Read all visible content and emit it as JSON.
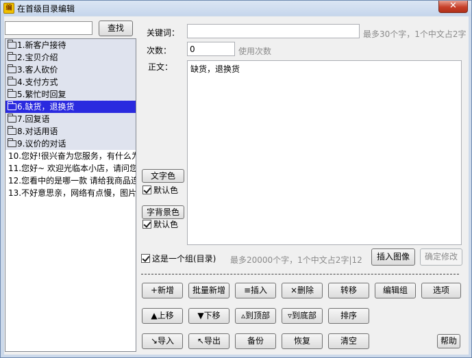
{
  "window": {
    "title": "在首级目录编辑",
    "close_glyph": "✕",
    "icon_glyph": "编"
  },
  "search": {
    "value": "",
    "button": "查找"
  },
  "tree": {
    "groups": [
      "1.新客户接待",
      "2.宝贝介绍",
      "3.客人砍价",
      "4.支付方式",
      "5.繁忙时回复",
      "6.缺货，退换货",
      "7.回复语",
      "8.对话用语",
      "9.议价的对话"
    ],
    "selected_index": 5,
    "items": [
      "10.您好!很兴奋为您服务，有什么为",
      "11.您好~ 欢迎光临本小店，请问您",
      "12.您看中的是哪一款 请给我商品连",
      "13.不好意思亲，网络有点慢，图片"
    ]
  },
  "form": {
    "keyword_label": "关键词：",
    "keyword_value": "",
    "keyword_hint": "最多30个字，1个中文占2字",
    "count_label": "次数：",
    "count_value": "0",
    "count_hint": "使用次数",
    "body_label": "正文：",
    "body_value": "缺货，退换货",
    "text_color_button": "文字色",
    "text_color_default": "默认色",
    "bg_color_button": "字背景色",
    "bg_color_default": "默认色",
    "is_group_label": "这是一个组(目录)",
    "body_hint": "最多20000个字，1个中文占2字|12",
    "insert_image_button": "插入图像",
    "confirm_button": "确定修改"
  },
  "actions": {
    "row1": [
      "+新增",
      "批量新增",
      "≡插入",
      "×删除",
      "转移",
      "编辑组",
      "选项"
    ],
    "row2": [
      "▲上移",
      "▼下移",
      "▵到顶部",
      "▿到底部",
      "排序"
    ],
    "row3": [
      "↘导入",
      "↖导出",
      "备份",
      "恢复",
      "清空"
    ],
    "help": "帮助"
  }
}
